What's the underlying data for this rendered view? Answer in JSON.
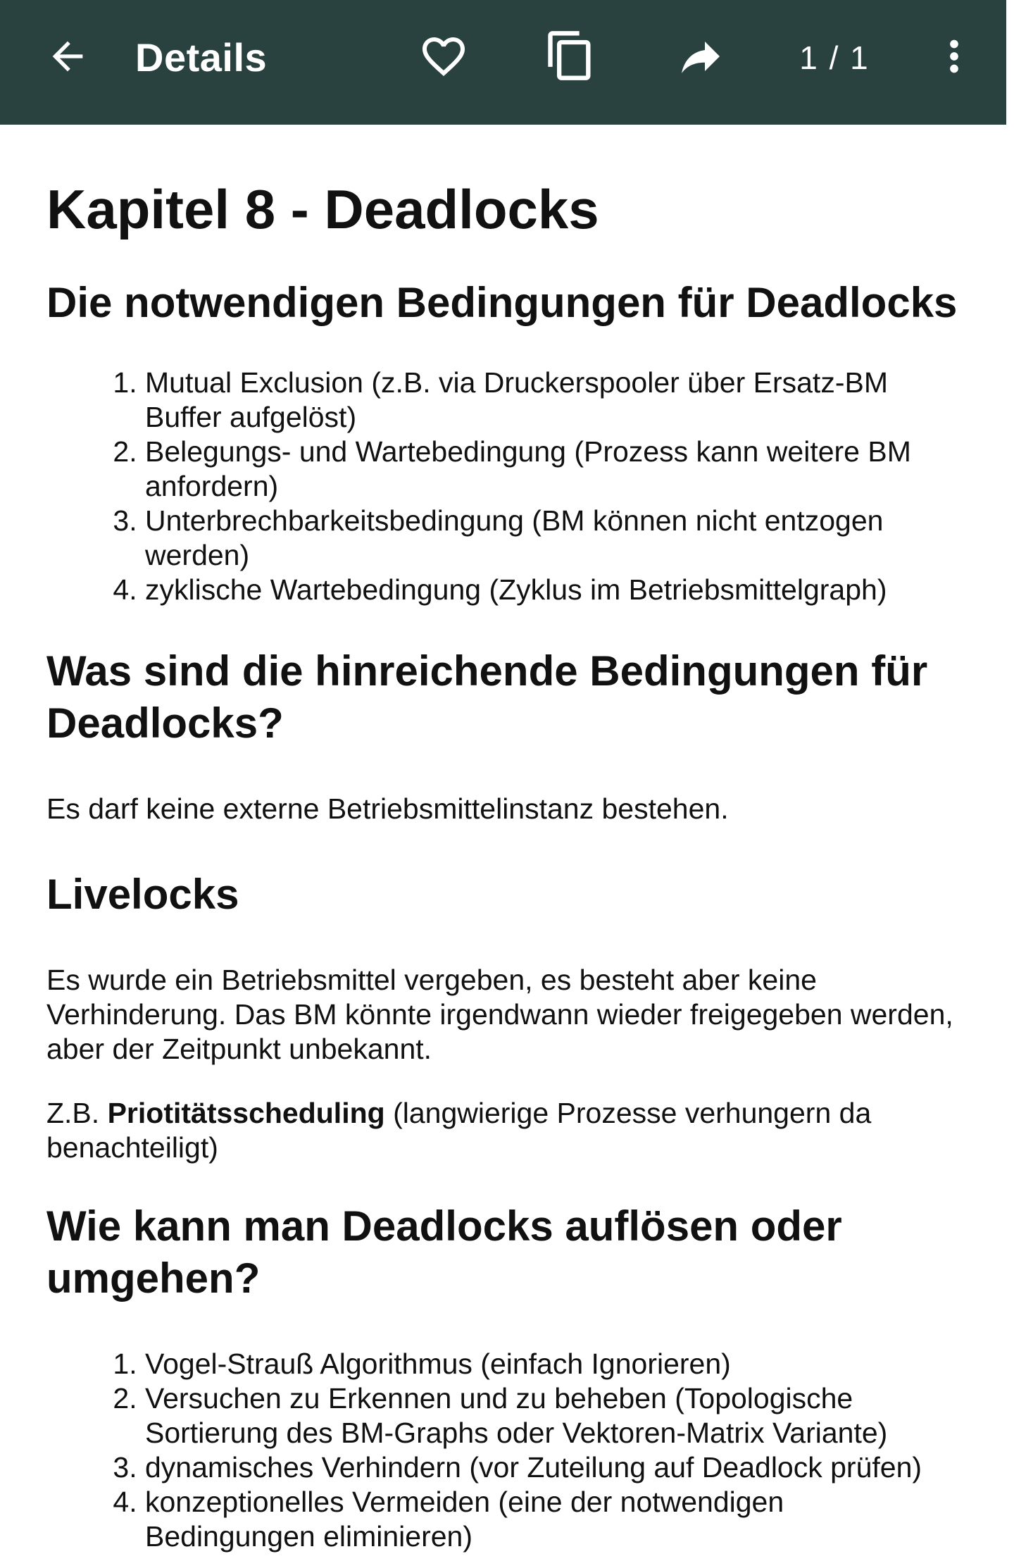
{
  "appbar": {
    "title": "Details",
    "page_counter": "1 / 1",
    "background_color": "#29423f",
    "icons": [
      "back-arrow-icon",
      "heart-icon",
      "copy-icon",
      "share-icon",
      "more-vert-icon"
    ]
  },
  "document": {
    "title": "Kapitel 8 - Deadlocks",
    "sections": [
      {
        "heading": "Die notwendigen Bedingungen für Deadlocks",
        "items": [
          "Mutual Exclusion (z.B. via Druckerspooler über Ersatz-BM Buffer aufgelöst)",
          "Belegungs- und Wartebedingung (Prozess kann weitere BM anfordern)",
          "Unterbrechbarkeitsbedingung (BM können nicht entzogen werden)",
          "zyklische Wartebedingung (Zyklus im Betriebsmittelgraph)"
        ]
      },
      {
        "heading": "Was sind die hinreichende Bedingungen für Deadlocks?",
        "paragraph": "Es darf keine externe Betriebsmittelinstanz bestehen."
      },
      {
        "heading": "Livelocks",
        "paragraph": "Es wurde ein Betriebsmittel vergeben, es besteht aber keine Verhinderung. Das BM könnte irgendwann wieder freigegeben werden, aber der Zeitpunkt unbekannt.",
        "example_prefix": "Z.B. ",
        "example_bold": "Priotitätsscheduling",
        "example_suffix": " (langwierige Prozesse verhungern da benachteiligt)"
      },
      {
        "heading": "Wie kann man Deadlocks auflösen oder umgehen?",
        "items": [
          "Vogel-Strauß Algorithmus (einfach Ignorieren)",
          "Versuchen zu Erkennen und zu beheben (Topologische Sortierung des BM-Graphs oder Vektoren-Matrix Variante)",
          "dynamisches Verhindern (vor Zuteilung auf Deadlock prüfen)",
          "konzeptionelles Vermeiden (eine der notwendigen Bedingungen eliminieren)"
        ]
      }
    ]
  }
}
